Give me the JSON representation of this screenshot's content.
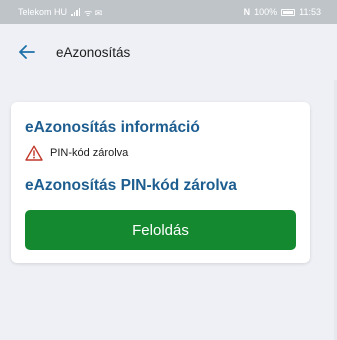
{
  "status_bar": {
    "carrier": "Telekom HU",
    "extra_icons": "ᯤ ✉",
    "nfc": "N",
    "battery": "100%",
    "time": "11:53"
  },
  "app_bar": {
    "title": "eAzonosítás",
    "back_icon": "arrow-left-icon"
  },
  "card": {
    "title": "eAzonosítás információ",
    "status_text": "PIN-kód zárolva",
    "status_icon": "warning-triangle-icon",
    "section_title": "eAzonosítás PIN-kód zárolva",
    "unlock_label": "Feloldás"
  },
  "colors": {
    "accent": "#1d5d8f",
    "button": "#14892f",
    "warning": "#c0392b",
    "background": "#eef0f5"
  }
}
